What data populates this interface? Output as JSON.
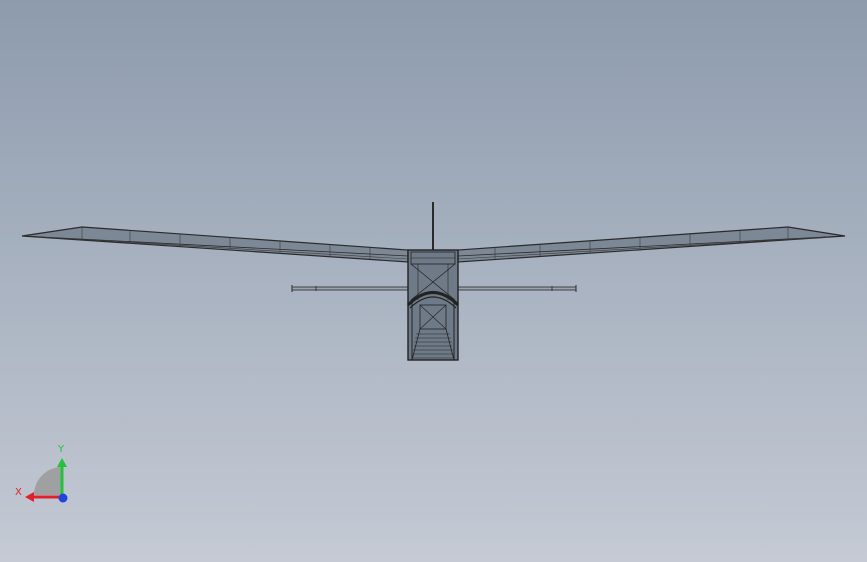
{
  "viewport": {
    "background_top": "#8d9bad",
    "background_bottom": "#c5cad4",
    "model_stroke": "#2a2a2a",
    "model_fill": "#7d8896"
  },
  "triad": {
    "x_label": "X",
    "y_label": "Y",
    "x_color": "#e0202a",
    "y_color": "#22c23a",
    "z_color": "#2244dd",
    "plane_color": "#9a9a9a"
  }
}
